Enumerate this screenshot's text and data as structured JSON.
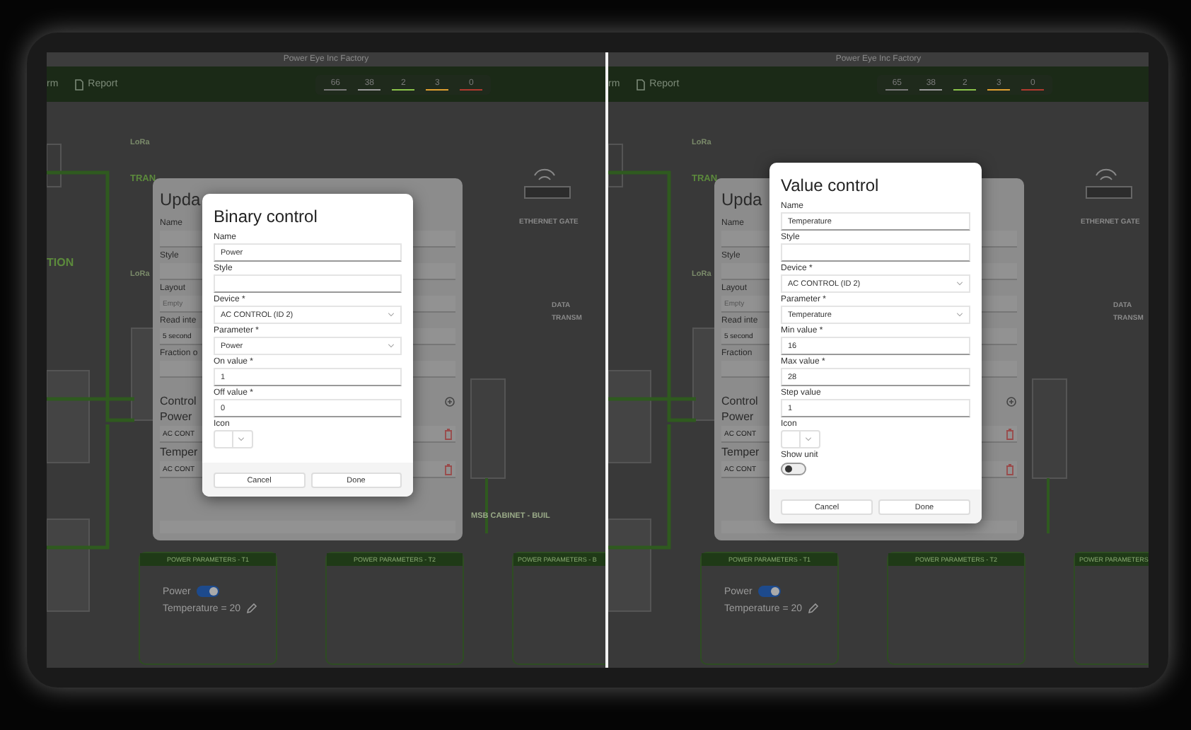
{
  "panels": [
    {
      "window_title": "Power Eye Inc Factory",
      "nav": [
        {
          "label": "rm"
        },
        {
          "label": "Report"
        }
      ],
      "counters": [
        {
          "value": "66",
          "color": "#7a7a7a"
        },
        {
          "value": "38",
          "color": "#9a9a9a"
        },
        {
          "value": "2",
          "color": "#8bc34a"
        },
        {
          "value": "3",
          "color": "#e0a030"
        },
        {
          "value": "0",
          "color": "#b03a2e"
        }
      ],
      "diagram_labels": [
        {
          "text": "LoRa",
          "kind": "lora-upper"
        },
        {
          "text": "TRAN",
          "kind": "transmitter"
        },
        {
          "text": "LoRa",
          "kind": "lora-lower"
        },
        {
          "text": "TION",
          "kind": "station"
        },
        {
          "text": "ETHERNET GATE",
          "kind": "gateway"
        },
        {
          "text": "DATA",
          "kind": "data"
        },
        {
          "text": "TRANSM",
          "kind": "data-sub"
        },
        {
          "text": "MSB CABINET - BUIL",
          "kind": "cabinet"
        }
      ],
      "back_dialog": {
        "title": "Upda",
        "fields": [
          {
            "label": "Name"
          },
          {
            "label": "Style"
          },
          {
            "label": "Layout",
            "placeholder": "Empty"
          },
          {
            "label": "Read inte",
            "value": "5 second"
          },
          {
            "label": "Fraction o"
          }
        ],
        "section": "Control",
        "controls": [
          {
            "name": "Power",
            "device": "AC CONT"
          },
          {
            "name": "Temper",
            "device": "AC CONT"
          }
        ]
      },
      "modal": {
        "title": "Binary control",
        "fields": [
          {
            "kind": "text",
            "label": "Name",
            "value": "Power"
          },
          {
            "kind": "text",
            "label": "Style"
          },
          {
            "kind": "select",
            "label": "Device *",
            "value": "AC CONTROL (ID 2)"
          },
          {
            "kind": "select",
            "label": "Parameter *",
            "value": "Power"
          },
          {
            "kind": "text",
            "label": "On value *",
            "value": "1"
          },
          {
            "kind": "text",
            "label": "Off value *",
            "value": "0"
          },
          {
            "kind": "icon",
            "label": "Icon"
          }
        ],
        "buttons": [
          "Cancel",
          "Done"
        ]
      },
      "cards": [
        {
          "title": "POWER PARAMETERS - T1",
          "items": [
            {
              "kind": "switch",
              "label": "Power",
              "on": true
            },
            {
              "kind": "reading",
              "label": "Temperature = 20"
            }
          ]
        },
        {
          "title": "POWER PARAMETERS - T2"
        },
        {
          "title": "POWER PARAMETERS - B"
        }
      ]
    },
    {
      "window_title": "Power Eye Inc Factory",
      "nav": [
        {
          "label": "rm"
        },
        {
          "label": "Report"
        }
      ],
      "counters": [
        {
          "value": "65",
          "color": "#7a7a7a"
        },
        {
          "value": "38",
          "color": "#9a9a9a"
        },
        {
          "value": "2",
          "color": "#8bc34a"
        },
        {
          "value": "3",
          "color": "#e0a030"
        },
        {
          "value": "0",
          "color": "#b03a2e"
        }
      ],
      "diagram_labels": [
        {
          "text": "LoRa",
          "kind": "lora-upper"
        },
        {
          "text": "TRAN",
          "kind": "transmitter"
        },
        {
          "text": "LoRa",
          "kind": "lora-lower"
        },
        {
          "text": "ETHERNET GATE",
          "kind": "gateway"
        },
        {
          "text": "DATA",
          "kind": "data"
        },
        {
          "text": "TRANSM",
          "kind": "data-sub"
        }
      ],
      "back_dialog": {
        "title": "Upda",
        "fields": [
          {
            "label": "Name"
          },
          {
            "label": "Style"
          },
          {
            "label": "Layout",
            "placeholder": "Empty"
          },
          {
            "label": "Read inte",
            "value": "5 second"
          },
          {
            "label": "Fraction"
          }
        ],
        "section": "Control",
        "controls": [
          {
            "name": "Power",
            "device": "AC CONT"
          },
          {
            "name": "Temper",
            "device": "AC CONT"
          }
        ]
      },
      "modal": {
        "title": "Value control",
        "fields": [
          {
            "kind": "text",
            "label": "Name",
            "value": "Temperature"
          },
          {
            "kind": "text",
            "label": "Style"
          },
          {
            "kind": "select",
            "label": "Device *",
            "value": "AC CONTROL (ID 2)"
          },
          {
            "kind": "select",
            "label": "Parameter *",
            "value": "Temperature"
          },
          {
            "kind": "text",
            "label": "Min value *",
            "value": "16"
          },
          {
            "kind": "text",
            "label": "Max value *",
            "value": "28"
          },
          {
            "kind": "text",
            "label": "Step value",
            "value": "1"
          },
          {
            "kind": "icon",
            "label": "Icon"
          },
          {
            "kind": "toggle",
            "label": "Show unit",
            "on": false
          }
        ],
        "buttons": [
          "Cancel",
          "Done"
        ]
      },
      "cards": [
        {
          "title": "POWER PARAMETERS - T1",
          "items": [
            {
              "kind": "switch",
              "label": "Power",
              "on": true
            },
            {
              "kind": "reading",
              "label": "Temperature = 20"
            }
          ]
        },
        {
          "title": "POWER PARAMETERS - T2"
        },
        {
          "title": "POWER PARAMETERS"
        }
      ]
    }
  ]
}
